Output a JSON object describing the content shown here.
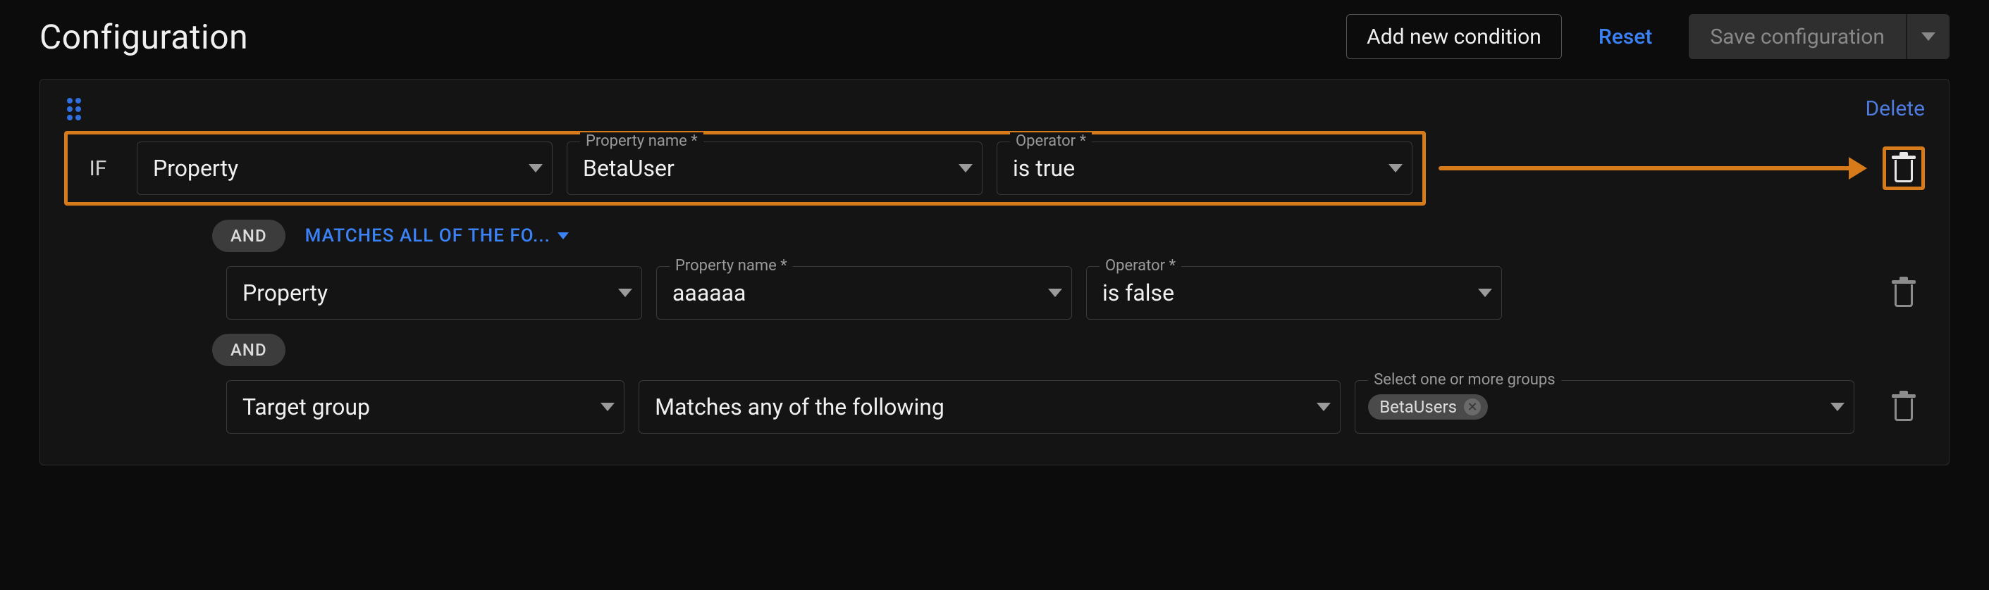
{
  "header": {
    "title": "Configuration",
    "add_btn": "Add new condition",
    "reset_btn": "Reset",
    "save_btn": "Save configuration"
  },
  "group": {
    "delete_label": "Delete",
    "if_label": "IF",
    "and_label": "AND",
    "matches_dropdown_label": "MATCHES ALL OF THE FO..."
  },
  "labels": {
    "property_name": "Property name *",
    "operator": "Operator *",
    "select_groups": "Select one or more groups"
  },
  "rows": [
    {
      "type": "Property",
      "property": "BetaUser",
      "operator": "is true"
    },
    {
      "type": "Property",
      "property": "aaaaaa",
      "operator": "is false"
    },
    {
      "type": "Target group",
      "match": "Matches any of the following",
      "group_tag": "BetaUsers"
    }
  ]
}
